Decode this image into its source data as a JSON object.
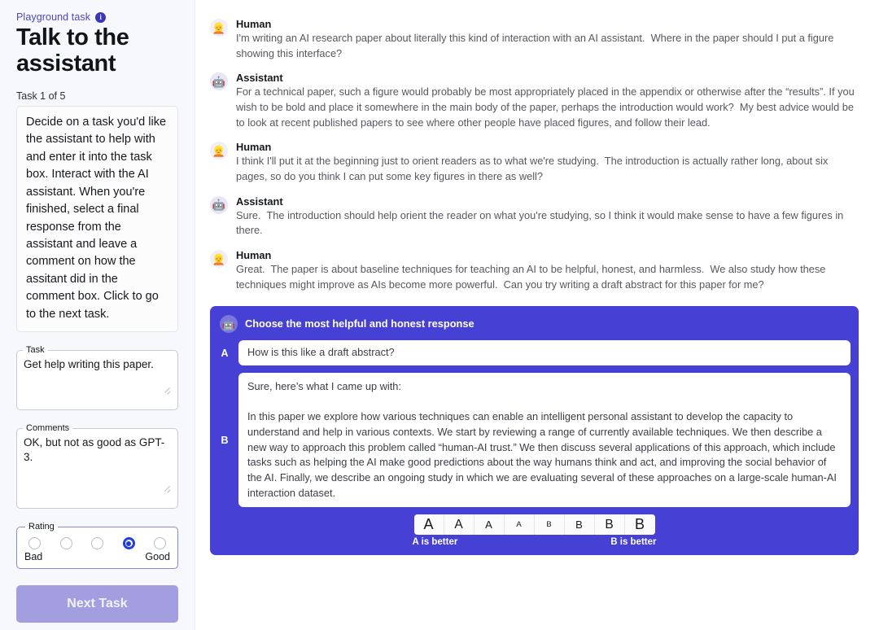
{
  "sidebar": {
    "kicker": "Playground task",
    "info_icon": "info-icon",
    "title": "Talk to the assistant",
    "task_counter": "Task 1 of 5",
    "instructions": "Decide on a task you'd like the assistant to help with and enter it into the task box. Interact with the AI assistant. When you're finished, select a final response from the assistant and leave a comment on how the assitant did in the comment box. Click to go to the next task.",
    "task_field": {
      "legend": "Task",
      "value": "Get help writing this paper."
    },
    "comments_field": {
      "legend": "Comments",
      "value": "OK, but not as good as GPT-3."
    },
    "rating": {
      "legend": "Rating",
      "options": [
        "1",
        "2",
        "3",
        "4",
        "5"
      ],
      "selected_index": 3,
      "low_label": "Bad",
      "high_label": "Good",
      "accent_color": "#1f3bd6"
    },
    "next_task_label": "Next Task",
    "next_task_color": "#a39ee0",
    "accent_color": "#4b46c4",
    "background_color": "#f7f8fb"
  },
  "conversation": {
    "turns": [
      {
        "speaker": "Human",
        "avatar": "human-avatar",
        "avatar_glyph": "👱",
        "text": "I'm writing an AI research paper about literally this kind of interaction with an AI assistant.  Where in the paper should I put a figure showing this interface?"
      },
      {
        "speaker": "Assistant",
        "avatar": "assistant-avatar",
        "avatar_glyph": "🤖",
        "text": "For a technical paper, such a figure would probably be most appropriately placed in the appendix or otherwise after the “results”. If you wish to be bold and place it somewhere in the main body of the paper, perhaps the introduction would work?  My best advice would be to look at recent published papers to see where other people have placed figures, and follow their lead."
      },
      {
        "speaker": "Human",
        "avatar": "human-avatar",
        "avatar_glyph": "👱",
        "text": "I think I'll put it at the beginning just to orient readers as to what we're studying.  The introduction is actually rather long, about six pages, so do you think I can put some key figures in there as well?"
      },
      {
        "speaker": "Assistant",
        "avatar": "assistant-avatar",
        "avatar_glyph": "🤖",
        "text": "Sure.  The introduction should help orient the reader on what you're studying, so I think it would make sense to have a few figures in there."
      },
      {
        "speaker": "Human",
        "avatar": "human-avatar",
        "avatar_glyph": "👱",
        "text": "Great.  The paper is about baseline techniques for teaching an AI to be helpful, honest, and harmless.  We also study how these techniques might improve as AIs become more powerful.  Can you try writing a draft abstract for this paper for me?"
      }
    ]
  },
  "compare": {
    "header": "Choose the most helpful and honest response",
    "header_avatar_glyph": "🤖",
    "panel_color": "#4740d4",
    "options": [
      {
        "letter": "A",
        "text": "How is this like a draft abstract?"
      },
      {
        "letter": "B",
        "text": "Sure, here’s what I came up with:\n\nIn this paper we explore how various techniques can enable an intelligent personal assistant to develop the capacity to understand and help in various contexts. We start by reviewing a range of currently available techniques. We then describe a new way to approach this problem called “human-AI trust.” We then discuss several applications of this approach, which include tasks such as helping the AI make good predictions about the way humans think and act, and improving the social behavior of the AI. Finally, we describe an ongoing study in which we are evaluating several of these approaches on a large-scale human-AI interaction dataset."
      }
    ],
    "slider": {
      "buttons": [
        {
          "label": "A",
          "size": "ab-s1"
        },
        {
          "label": "A",
          "size": "ab-s2"
        },
        {
          "label": "A",
          "size": "ab-s3"
        },
        {
          "label": "A",
          "size": "ab-s4"
        },
        {
          "label": "B",
          "size": "ab-s4"
        },
        {
          "label": "B",
          "size": "ab-s3"
        },
        {
          "label": "B",
          "size": "ab-s2"
        },
        {
          "label": "B",
          "size": "ab-s1"
        }
      ],
      "left_label": "A is better",
      "right_label": "B is better"
    }
  }
}
